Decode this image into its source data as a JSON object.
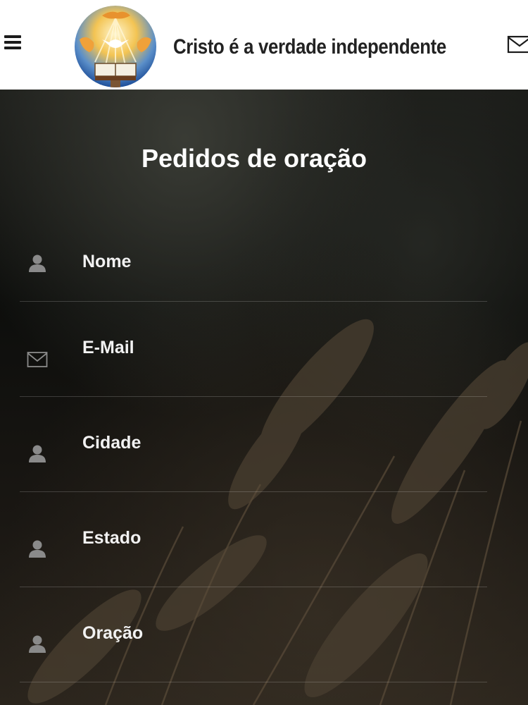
{
  "header": {
    "site_title": "Cristo é a verdade independente",
    "menu_icon": "hamburger-menu-icon",
    "mail_icon": "envelope-icon",
    "logo": "church-logo-hands-dove-bible"
  },
  "form": {
    "title": "Pedidos de oração",
    "fields": [
      {
        "placeholder": "Nome",
        "icon": "user-icon",
        "value": ""
      },
      {
        "placeholder": "E-Mail",
        "icon": "envelope-icon",
        "value": ""
      },
      {
        "placeholder": "Cidade",
        "icon": "user-icon",
        "value": ""
      },
      {
        "placeholder": "Estado",
        "icon": "user-icon",
        "value": ""
      },
      {
        "placeholder": "Oração",
        "icon": "user-icon",
        "value": ""
      }
    ]
  },
  "colors": {
    "header_bg": "#ffffff",
    "title_text": "#222222",
    "form_text": "#ffffff",
    "field_divider": "#3a3833",
    "icon_gray": "#8a8a8a",
    "background": "#0c0c0b"
  }
}
